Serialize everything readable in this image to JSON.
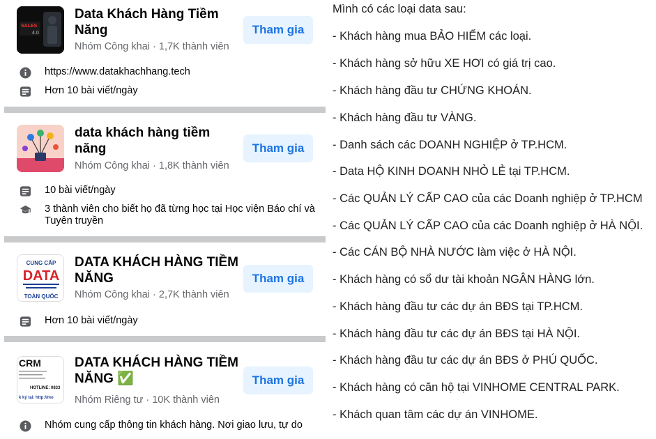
{
  "groups": [
    {
      "name": "Data Khách Hàng Tiềm Năng",
      "meta": "Nhóm Công khai · 1,7K thành viên",
      "join_label": "Tham gia",
      "thumb_text_a": "SALES",
      "thumb_text_b": "4.0",
      "info": [
        {
          "icon": "info-icon",
          "text": "https://www.datakhachhang.tech"
        },
        {
          "icon": "posts-icon",
          "text": "Hơn 10 bài viết/ngày"
        }
      ]
    },
    {
      "name": "data khách hàng tiềm năng",
      "meta": "Nhóm Công khai · 1,8K thành viên",
      "join_label": "Tham gia",
      "info": [
        {
          "icon": "posts-icon",
          "text": "10 bài viết/ngày"
        },
        {
          "icon": "graduation-cap-icon",
          "text": "3 thành viên cho biết họ đã từng học tại Học viện Báo chí và Tuyên truyền"
        }
      ]
    },
    {
      "name": "DATA KHÁCH HÀNG TIỀM NĂNG",
      "meta": "Nhóm Công khai · 2,7K thành viên",
      "join_label": "Tham gia",
      "thumb_text_a": "CUNG CẤP",
      "thumb_text_b": "DATA",
      "thumb_text_c": "TOÀN QUỐC",
      "info": [
        {
          "icon": "posts-icon",
          "text": "Hơn 10 bài viết/ngày"
        }
      ]
    },
    {
      "name_line1": "DATA KHÁCH HÀNG TIỀM",
      "name_line2": "NĂNG",
      "verified_emoji": "✅",
      "meta": "Nhóm Riêng tư · 10K thành viên",
      "join_label": "Tham gia",
      "thumb_text_a": "CRM",
      "thumb_text_b": "HOTLINE: 0833",
      "thumb_text_c": "k ký tại: http://mo",
      "info": [
        {
          "icon": "info-icon",
          "text": "Nhóm cung cấp thông tin khách hàng. Nơi giao lưu, tự do"
        }
      ]
    }
  ],
  "data_list": {
    "intro": "Mình có các loại data sau:",
    "items": [
      "- Khách hàng mua BẢO HIỂM các loại.",
      "- Khách hàng sở hữu XE HƠI có giá trị cao.",
      "- Khách hàng đầu tư CHỨNG KHOÁN.",
      "- Khách hàng đầu tư VÀNG.",
      "- Danh sách các DOANH NGHIỆP ở TP.HCM.",
      "- Data HỘ KINH DOANH NHỎ LẺ tại TP.HCM.",
      "- Các QUẢN LÝ CẤP CAO của các Doanh nghiệp ở TP.HCM",
      "- Các QUẢN LÝ CẤP CAO của các Doanh nghiệp ở HÀ NỘI.",
      "- Các CÁN BỘ NHÀ NƯỚC làm việc ở HÀ NỘI.",
      "- Khách hàng có sổ dư tài khoản NGÂN HÀNG lớn.",
      "- Khách hàng đầu tư các dự án BĐS tại TP.HCM.",
      "- Khách hàng đầu tư các dự án BĐS tại HÀ NỘI.",
      "- Khách hàng đầu tư các dự án BĐS ở PHÚ QUỐC.",
      "- Khách hàng có căn hộ tại VINHOME CENTRAL PARK.",
      "- Khách quan tâm các dự án VINHOME."
    ]
  },
  "colors": {
    "join_bg": "#e7f3ff",
    "join_text": "#1b74e4",
    "meta_text": "#65676b",
    "separator": "#c9cacc"
  }
}
